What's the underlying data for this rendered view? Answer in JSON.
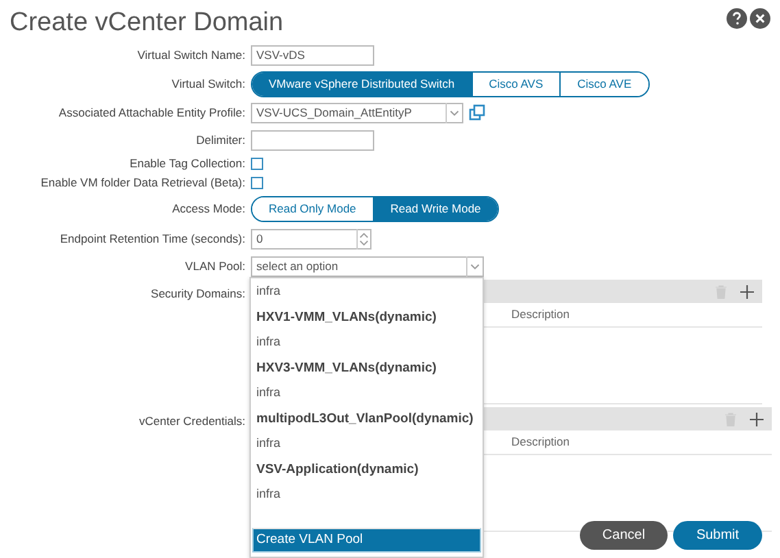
{
  "dialog": {
    "title": "Create vCenter Domain"
  },
  "form": {
    "virtual_switch_name": {
      "label": "Virtual Switch Name:",
      "value": "VSV-vDS"
    },
    "virtual_switch": {
      "label": "Virtual Switch:",
      "options": [
        {
          "label": "VMware vSphere Distributed Switch",
          "selected": true
        },
        {
          "label": "Cisco AVS",
          "selected": false
        },
        {
          "label": "Cisco AVE",
          "selected": false
        }
      ]
    },
    "aaep": {
      "label": "Associated Attachable Entity Profile:",
      "value": "VSV-UCS_Domain_AttEntityP"
    },
    "delimiter": {
      "label": "Delimiter:"
    },
    "enable_tag_collection": {
      "label": "Enable Tag Collection:",
      "checked": false
    },
    "enable_vm_folder": {
      "label": "Enable VM folder Data Retrieval (Beta):",
      "checked": false
    },
    "access_mode": {
      "label": "Access Mode:",
      "options": [
        {
          "label": "Read Only Mode",
          "selected": false
        },
        {
          "label": "Read Write Mode",
          "selected": true
        }
      ]
    },
    "endpoint_retention": {
      "label": "Endpoint Retention Time (seconds):",
      "value": "0"
    },
    "vlan_pool": {
      "label": "VLAN Pool:",
      "placeholder": "select an option",
      "expanded": true,
      "options": [
        {
          "sub": "infra"
        },
        {
          "name": "HXV1-VMM_VLANs(dynamic)",
          "sub": "infra"
        },
        {
          "name": "HXV3-VMM_VLANs(dynamic)",
          "sub": "infra"
        },
        {
          "name": "multipodL3Out_VlanPool(dynamic)",
          "sub": "infra"
        },
        {
          "name": "VSV-Application(dynamic)",
          "sub": "infra"
        }
      ],
      "create_action": "Create VLAN Pool"
    },
    "security_domains": {
      "label": "Security Domains:",
      "column": "Description"
    },
    "vcenter_credentials": {
      "label": "vCenter Credentials:",
      "column": "Description"
    }
  },
  "buttons": [
    {
      "label": "Cancel",
      "kind": "secondary"
    },
    {
      "label": "Submit",
      "kind": "primary"
    }
  ]
}
